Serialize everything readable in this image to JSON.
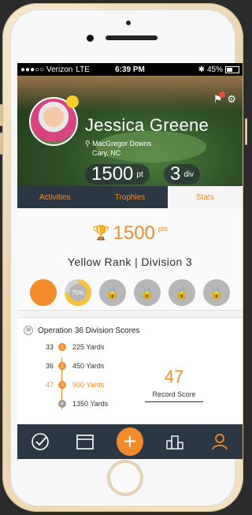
{
  "status_bar": {
    "carrier": "●●●○○ Verizon",
    "network": "LTE",
    "time": "6:39 PM",
    "bluetooth_icon": "bluetooth-icon",
    "battery": "45%"
  },
  "profile": {
    "name": "Jessica Greene",
    "location_line1": "MacGregor Downs",
    "location_line2": "Cary, NC",
    "points_value": "1500",
    "points_unit": "pt",
    "division_value": "3",
    "division_unit": "div"
  },
  "tabs": [
    {
      "label": "Activities",
      "active": false
    },
    {
      "label": "Trophies",
      "active": false
    },
    {
      "label": "Stats",
      "active": true
    }
  ],
  "stats": {
    "points": "1500",
    "points_suffix": "pts",
    "rank_text": "Yellow Rank | Division 3",
    "badges": [
      {
        "type": "complete",
        "icon": "filled-circle-icon"
      },
      {
        "type": "progress",
        "label": "75%",
        "progress": 0.75
      },
      {
        "type": "locked",
        "icon": "lock-icon"
      },
      {
        "type": "locked",
        "icon": "lock-icon"
      },
      {
        "type": "locked",
        "icon": "lock-icon"
      },
      {
        "type": "locked",
        "icon": "lock-icon"
      }
    ]
  },
  "division": {
    "title": "Operation 36 Division Scores",
    "rows": [
      {
        "score": "33",
        "step": "1",
        "yards": "225 Yards",
        "state": "complete"
      },
      {
        "score": "36",
        "step": "2",
        "yards": "450 Yards",
        "state": "complete"
      },
      {
        "score": "47",
        "step": "3",
        "yards": "900 Yards",
        "state": "current"
      },
      {
        "score": "",
        "step": "4",
        "yards": "1350 Yards",
        "state": "locked"
      }
    ],
    "record_value": "47",
    "record_label": "Record Score"
  },
  "bottom_nav": {
    "items": [
      {
        "name": "checkmark-icon"
      },
      {
        "name": "calendar-icon"
      },
      {
        "name": "add-icon"
      },
      {
        "name": "leaderboard-icon"
      },
      {
        "name": "profile-icon"
      }
    ]
  },
  "colors": {
    "accent": "#f28b2c",
    "nav_bg": "#2b3743"
  }
}
